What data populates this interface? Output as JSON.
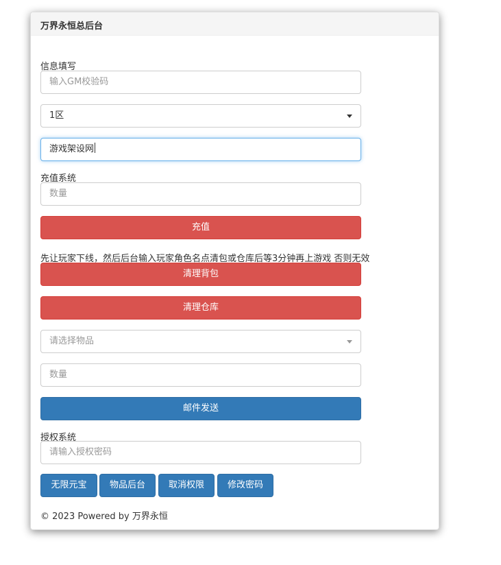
{
  "panel": {
    "title": "万界永恒总后台"
  },
  "info": {
    "label": "信息填写",
    "gm_code_placeholder": "输入GM校验码",
    "server_selected": "1区",
    "role_value": "游戏架设网"
  },
  "recharge": {
    "label": "充值系统",
    "amount_placeholder": "数量",
    "button": "充值"
  },
  "notice": "先让玩家下线，然后后台输入玩家角色名点清包或仓库后等3分钟再上游戏 否则无效",
  "clear": {
    "bag_button": "清理背包",
    "warehouse_button": "清理仓库"
  },
  "mail": {
    "item_placeholder": "请选择物品",
    "qty_placeholder": "数量",
    "send_button": "邮件发送"
  },
  "auth": {
    "label": "授权系统",
    "password_placeholder": "请输入授权密码",
    "buttons": [
      "无限元宝",
      "物品后台",
      "取消权限",
      "修改密码"
    ]
  },
  "footer": "© 2023 Powered by 万界永恒",
  "colors": {
    "danger": "#d9534f",
    "primary": "#337ab7",
    "focus": "#66afe9"
  }
}
